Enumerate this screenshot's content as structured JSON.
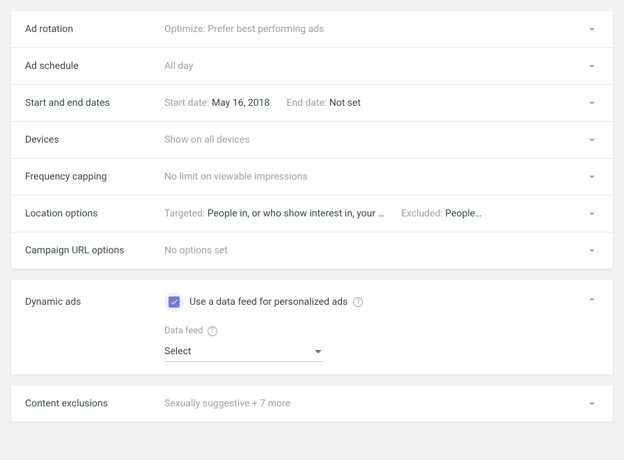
{
  "settings": [
    {
      "label": "Ad rotation",
      "value": "Optimize: Prefer best performing ads"
    },
    {
      "label": "Ad schedule",
      "value": "All day"
    },
    {
      "label": "Start and end dates",
      "start_prefix": "Start date: ",
      "start_value": "May 16, 2018",
      "end_prefix": "End date: ",
      "end_value": "Not set"
    },
    {
      "label": "Devices",
      "value": "Show on all devices"
    },
    {
      "label": "Frequency capping",
      "value": "No limit on viewable impressions"
    },
    {
      "label": "Location options",
      "targeted_prefix": "Targeted: ",
      "targeted_value": "People in, or who show interest in, your …",
      "excluded_prefix": "Excluded: ",
      "excluded_value": "People…"
    },
    {
      "label": "Campaign URL options",
      "value": "No options set"
    }
  ],
  "dynamic_ads": {
    "label": "Dynamic ads",
    "checkbox_label": "Use a data feed for personalized ads",
    "field_label": "Data feed",
    "select_value": "Select"
  },
  "content_exclusions": {
    "label": "Content exclusions",
    "value": "Sexually suggestive + 7 more"
  }
}
